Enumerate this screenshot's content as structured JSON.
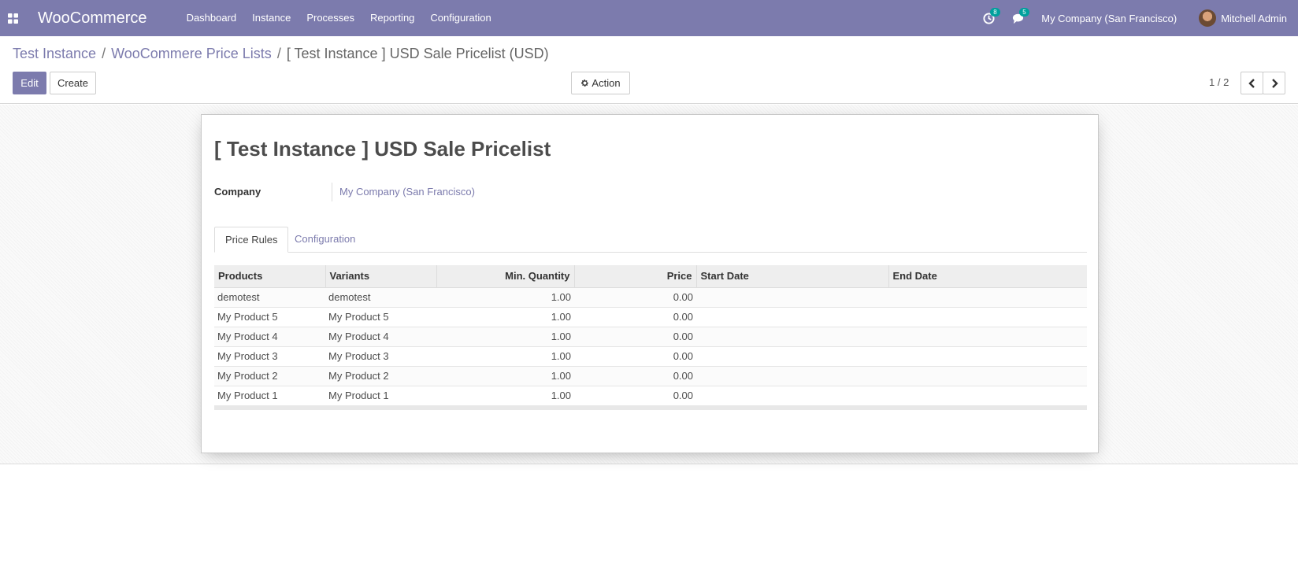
{
  "navbar": {
    "brand": "WooCommerce",
    "menu": [
      "Dashboard",
      "Instance",
      "Processes",
      "Reporting",
      "Configuration"
    ],
    "activity_count": "8",
    "message_count": "5",
    "company": "My Company (San Francisco)",
    "user": "Mitchell Admin"
  },
  "breadcrumb": {
    "items": [
      "Test Instance",
      "WooCommere Price Lists"
    ],
    "separator": "/",
    "current": "[ Test Instance ] USD Sale Pricelist (USD)"
  },
  "buttons": {
    "edit": "Edit",
    "create": "Create",
    "action": "Action"
  },
  "pager": {
    "value": "1 / 2"
  },
  "form": {
    "title": "[ Test Instance ] USD Sale Pricelist",
    "company_label": "Company",
    "company_value": "My Company (San Francisco)",
    "tabs": [
      "Price Rules",
      "Configuration"
    ],
    "columns": [
      "Products",
      "Variants",
      "Min. Quantity",
      "Price",
      "Start Date",
      "End Date"
    ],
    "rows": [
      [
        "demotest",
        "demotest",
        "1.00",
        "0.00",
        "",
        ""
      ],
      [
        "My Product 5",
        "My Product 5",
        "1.00",
        "0.00",
        "",
        ""
      ],
      [
        "My Product 4",
        "My Product 4",
        "1.00",
        "0.00",
        "",
        ""
      ],
      [
        "My Product 3",
        "My Product 3",
        "1.00",
        "0.00",
        "",
        ""
      ],
      [
        "My Product 2",
        "My Product 2",
        "1.00",
        "0.00",
        "",
        ""
      ],
      [
        "My Product 1",
        "My Product 1",
        "1.00",
        "0.00",
        "",
        ""
      ]
    ]
  },
  "colors": {
    "brand": "#7c7bad",
    "badge": "#00a09d"
  }
}
